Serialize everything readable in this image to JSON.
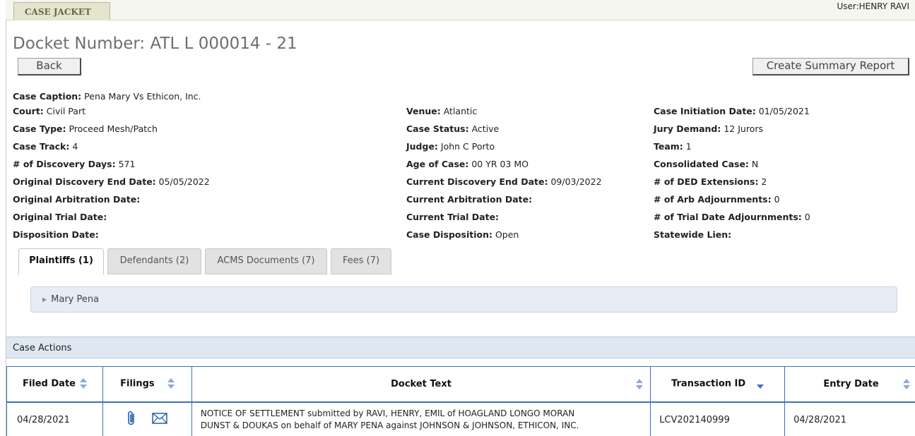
{
  "header": {
    "tab_label": "CASE JACKET",
    "user": "User:HENRY RAVI"
  },
  "docket": {
    "title": "Docket Number:  ATL L 000014 - 21"
  },
  "buttons": {
    "back": "Back",
    "summary": "Create Summary Report"
  },
  "case": {
    "caption": {
      "label": "Case Caption:",
      "value": " Pena Mary Vs Ethicon, Inc."
    },
    "col1": [
      {
        "label": "Court:",
        "value": " Civil Part"
      },
      {
        "label": "Case Type:",
        "value": " Proceed Mesh/Patch"
      },
      {
        "label": "Case Track:",
        "value": " 4"
      },
      {
        "label": "# of Discovery Days:",
        "value": " 571"
      },
      {
        "label": "Original Discovery End Date:",
        "value": " 05/05/2022"
      },
      {
        "label": "Original Arbitration Date:",
        "value": ""
      },
      {
        "label": "Original Trial Date:",
        "value": ""
      },
      {
        "label": "Disposition Date:",
        "value": ""
      }
    ],
    "col2": [
      {
        "label": "Venue:",
        "value": " Atlantic"
      },
      {
        "label": "Case Status:",
        "value": " Active"
      },
      {
        "label": "Judge:",
        "value": " John C Porto"
      },
      {
        "label": "Age of Case:",
        "value": " 00 YR 03 MO"
      },
      {
        "label": "Current Discovery End Date:",
        "value": " 09/03/2022"
      },
      {
        "label": "Current Arbitration Date:",
        "value": ""
      },
      {
        "label": "Current Trial Date:",
        "value": ""
      },
      {
        "label": "Case Disposition:",
        "value": " Open"
      }
    ],
    "col3": [
      {
        "label": "Case Initiation Date:",
        "value": " 01/05/2021"
      },
      {
        "label": "Jury Demand:",
        "value": " 12 Jurors"
      },
      {
        "label": "Team:",
        "value": " 1"
      },
      {
        "label": "Consolidated Case:",
        "value": "  N"
      },
      {
        "label": "# of DED Extensions:",
        "value": " 2"
      },
      {
        "label": "# of Arb Adjournments:",
        "value": " 0"
      },
      {
        "label": "# of Trial Date Adjournments:",
        "value": " 0"
      },
      {
        "label": "Statewide Lien:",
        "value": ""
      }
    ]
  },
  "tabs": [
    {
      "label": "Plaintiffs (1)"
    },
    {
      "label": "Defendants (2)"
    },
    {
      "label": "ACMS Documents (7)"
    },
    {
      "label": "Fees (7)"
    }
  ],
  "plaintiffs": [
    {
      "name": "Mary Pena"
    }
  ],
  "actions": {
    "title": "Case Actions",
    "columns": [
      "Filed Date",
      "Filings",
      "Docket Text",
      "Transaction ID",
      "Entry Date"
    ],
    "rows": [
      {
        "filed_date": "04/28/2021",
        "docket_text_line1": "NOTICE OF SETTLEMENT submitted by RAVI, HENRY, EMIL of HOAGLAND LONGO MORAN",
        "docket_text_line2": "DUNST & DOUKAS on behalf of MARY PENA against JOHNSON & JOHNSON, ETHICON, INC.",
        "transaction_id": "LCV202140999",
        "entry_date": "04/28/2021"
      }
    ]
  },
  "icons": {
    "attachment": "paperclip-icon",
    "email": "envelope-icon"
  }
}
